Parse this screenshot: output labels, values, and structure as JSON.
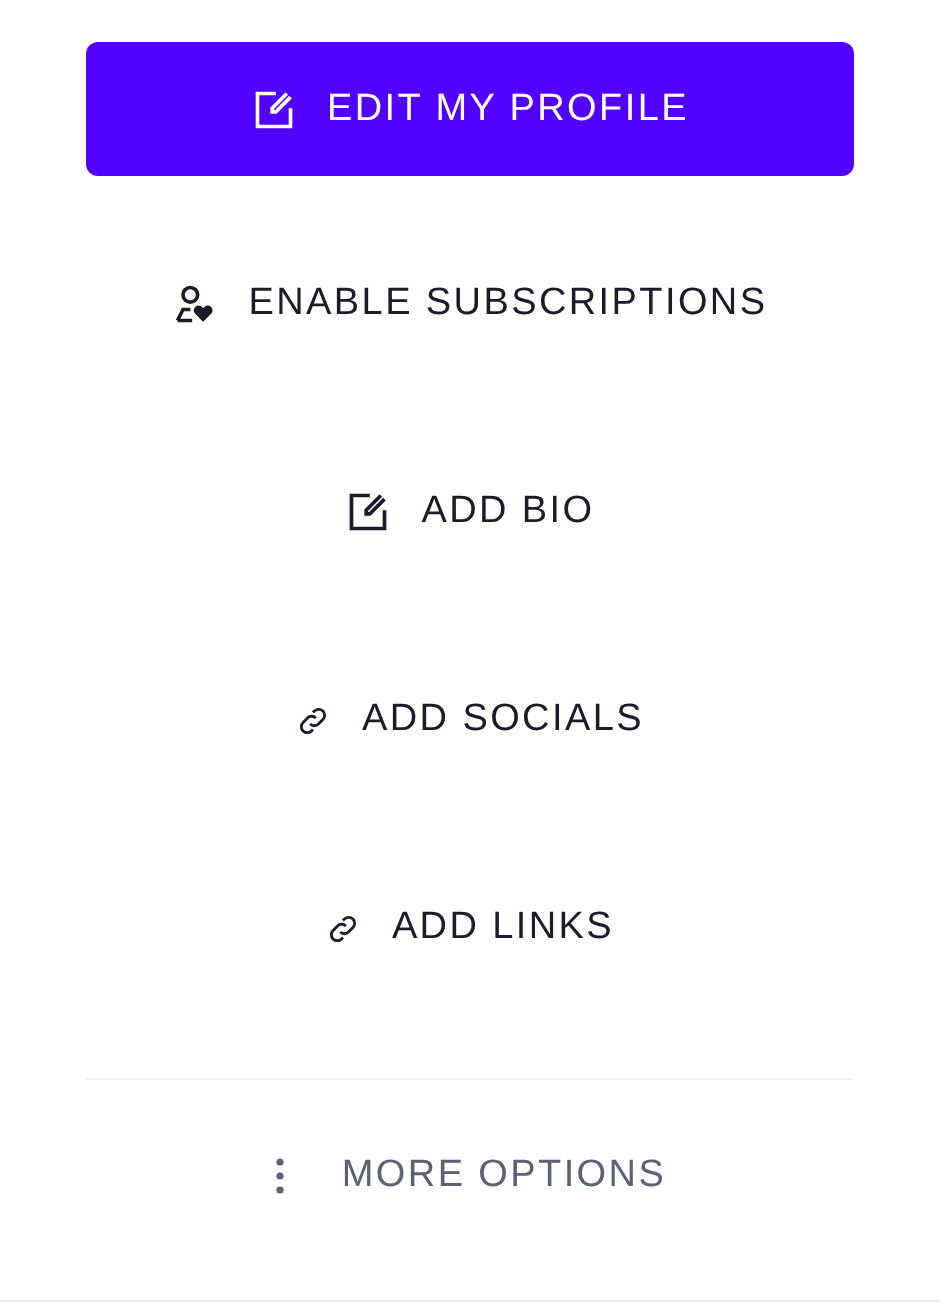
{
  "actions": [
    {
      "kind": "primary",
      "label": "EDIT MY PROFILE"
    },
    {
      "kind": "plain",
      "label": "ENABLE SUBSCRIPTIONS"
    },
    {
      "kind": "plain",
      "label": "ADD BIO"
    },
    {
      "kind": "plain",
      "label": "ADD SOCIALS"
    },
    {
      "kind": "plain",
      "label": "ADD LINKS"
    }
  ],
  "more": {
    "label": "MORE OPTIONS"
  }
}
